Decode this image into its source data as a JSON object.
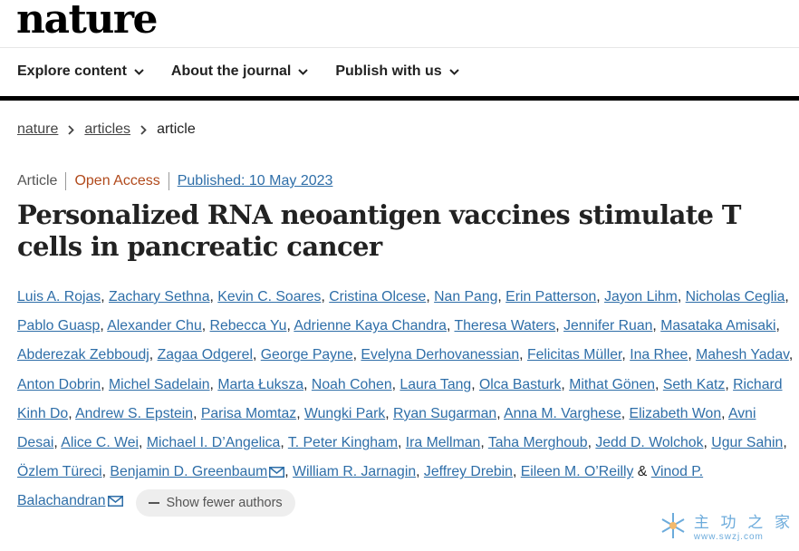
{
  "header": {
    "logo": "nature",
    "nav": [
      {
        "label": "Explore content"
      },
      {
        "label": "About the journal"
      },
      {
        "label": "Publish with us"
      }
    ]
  },
  "breadcrumb": {
    "items": [
      "nature",
      "articles"
    ],
    "current": "article"
  },
  "meta": {
    "type": "Article",
    "access": "Open Access",
    "published": "Published: 10 May 2023"
  },
  "article": {
    "title": "Personalized RNA neoantigen vaccines stimulate T cells in pancreatic cancer"
  },
  "authors": [
    "Luis A. Rojas",
    "Zachary Sethna",
    "Kevin C. Soares",
    "Cristina Olcese",
    "Nan Pang",
    "Erin Patterson",
    "Jayon Lihm",
    "Nicholas Ceglia",
    "Pablo Guasp",
    "Alexander Chu",
    "Rebecca Yu",
    "Adrienne Kaya Chandra",
    "Theresa Waters",
    "Jennifer Ruan",
    "Masataka Amisaki",
    "Abderezak Zebboudj",
    "Zagaa Odgerel",
    "George Payne",
    "Evelyna Derhovanessian",
    "Felicitas Müller",
    "Ina Rhee",
    "Mahesh Yadav",
    "Anton Dobrin",
    "Michel Sadelain",
    "Marta Łuksza",
    "Noah Cohen",
    "Laura Tang",
    "Olca Basturk",
    "Mithat Gönen",
    "Seth Katz",
    "Richard Kinh Do",
    "Andrew S. Epstein",
    "Parisa Momtaz",
    "Wungki Park",
    "Ryan Sugarman",
    "Anna M. Varghese",
    "Elizabeth Won",
    "Avni Desai",
    "Alice C. Wei",
    "Michael I. D’Angelica",
    "T. Peter Kingham",
    "Ira Mellman",
    "Taha Merghoub",
    "Jedd D. Wolchok",
    "Ugur Sahin",
    "Özlem Türeci",
    "Benjamin D. Greenbaum",
    "William R. Jarnagin",
    "Jeffrey Drebin",
    "Eileen M. O’Reilly",
    "Vinod P. Balachandran"
  ],
  "corresponding_authors": [
    "Benjamin D. Greenbaum",
    "Vinod P. Balachandran"
  ],
  "separator": ", ",
  "last_joiner": " & ",
  "show_fewer_label": "Show fewer authors",
  "watermark": {
    "cn": "主 功 之 家",
    "url": "www.swzj.com"
  },
  "colors": {
    "link": "#2e6ea8",
    "open_access": "#b14a1c",
    "nav_rule": "#000000"
  }
}
